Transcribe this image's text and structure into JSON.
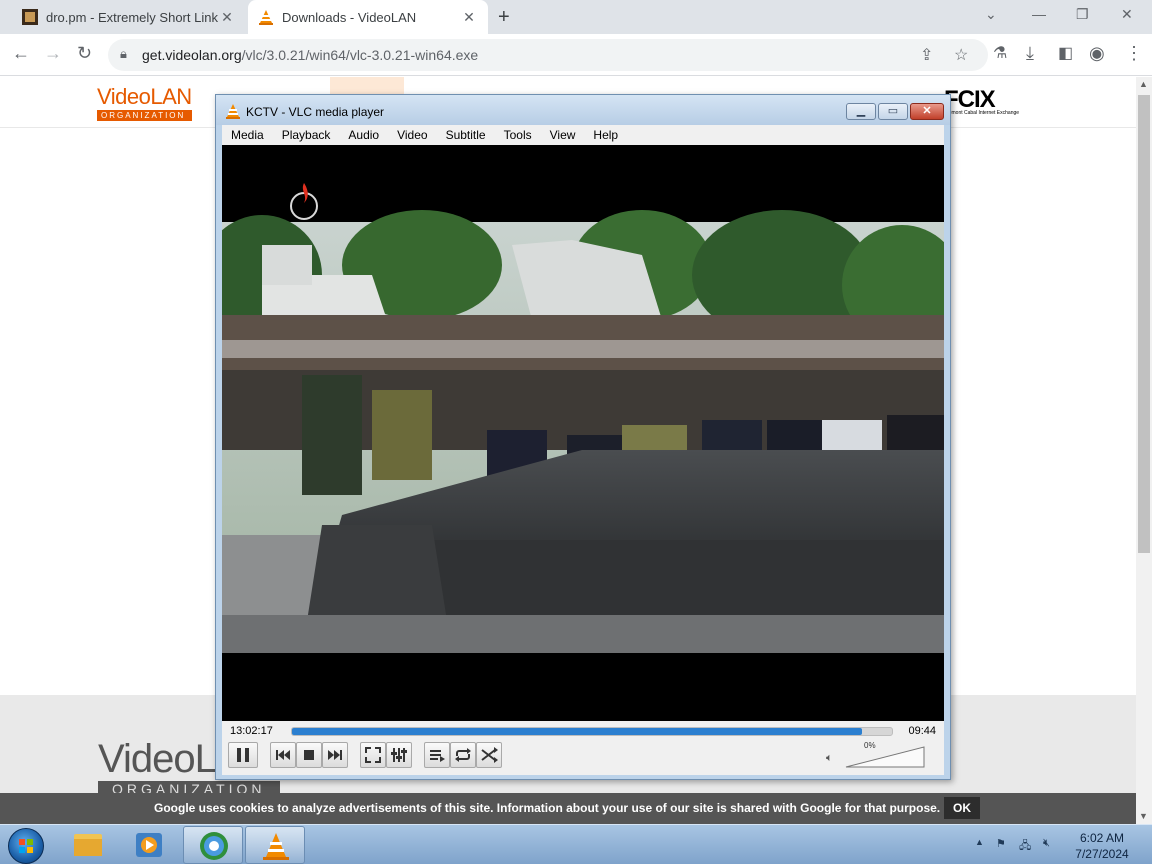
{
  "browser": {
    "tabs": [
      {
        "title": "dro.pm - Extremely Short Links",
        "active": false
      },
      {
        "title": "Downloads - VideoLAN",
        "active": true
      }
    ],
    "url_host": "get.videolan.org",
    "url_path": "/vlc/3.0.21/win64/vlc-3.0.21-win64.exe"
  },
  "page": {
    "logo_text": "VideoLAN",
    "logo_sub": "ORGANIZATION",
    "sponsor": "FCIX",
    "sponsor_sub": "Fremont Cabal Internet Exchange",
    "footer_logo": "VideoLA",
    "footer_org": "ORGANIZATION",
    "cookie_message": "Google uses cookies to analyze advertisements of this site. Information about your use of our site is shared with Google for that purpose.",
    "cookie_ok": "OK"
  },
  "vlc": {
    "title": "KCTV - VLC media player",
    "menu": [
      "Media",
      "Playback",
      "Audio",
      "Video",
      "Subtitle",
      "Tools",
      "View",
      "Help"
    ],
    "time_current": "13:02:17",
    "time_total": "09:44",
    "seek_progress": 0.95,
    "volume_label": "0%"
  },
  "taskbar": {
    "clock_time": "6:02 AM",
    "clock_date": "7/27/2024"
  },
  "colors": {
    "videolan_orange": "#e65a00",
    "vlc_seek_blue": "#2b7fd0",
    "cookie_bar": "#555555"
  }
}
